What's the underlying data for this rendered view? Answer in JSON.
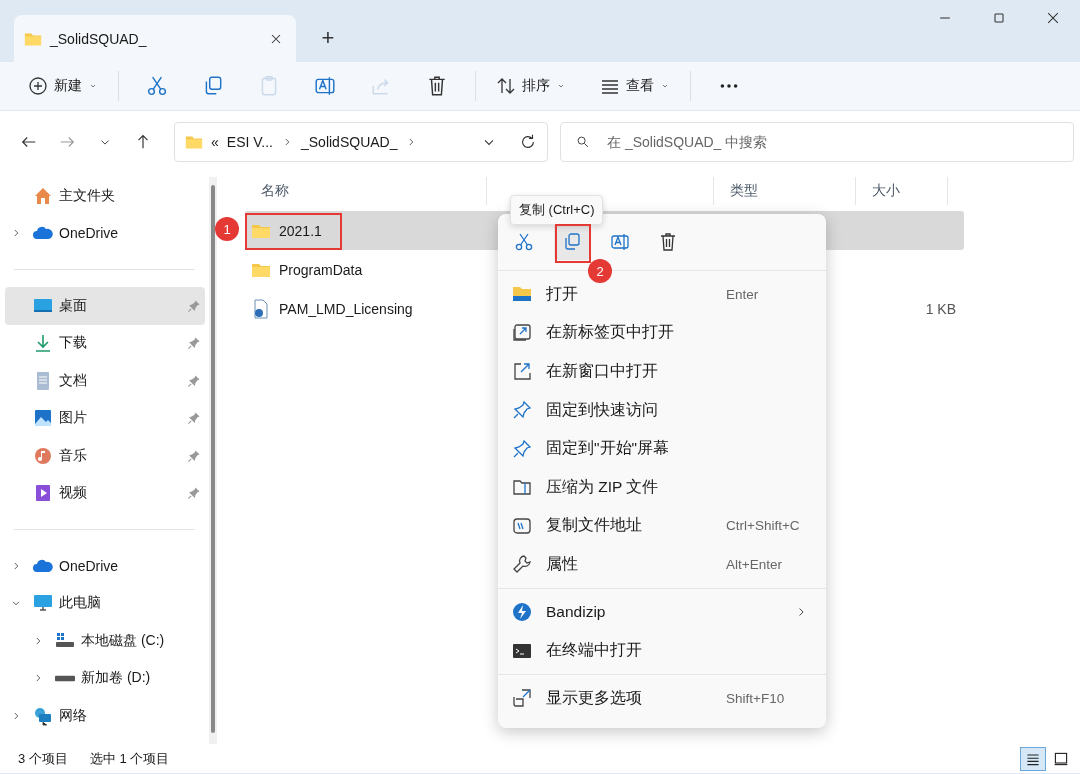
{
  "window": {
    "tab_title": "_SolidSQUAD_",
    "new_tab": "+"
  },
  "toolbar": {
    "new_label": "新建",
    "actions": [
      {
        "kind": "cut",
        "disabled": false
      },
      {
        "kind": "copy",
        "disabled": false
      },
      {
        "kind": "paste",
        "disabled": true
      },
      {
        "kind": "rename",
        "disabled": false
      },
      {
        "kind": "share",
        "disabled": true
      },
      {
        "kind": "delete",
        "disabled": false
      }
    ],
    "sort_label": "排序",
    "view_label": "查看"
  },
  "address": {
    "overflow": "«",
    "crumbs": [
      "ESI V...",
      "_SolidSQUAD_"
    ],
    "search_placeholder": "在 _SolidSQUAD_ 中搜索"
  },
  "sidebar": {
    "groups": [
      {
        "items": [
          {
            "label": "主文件夹",
            "kind": "home",
            "pinned": false,
            "selected": false
          },
          {
            "label": "OneDrive",
            "kind": "cloud",
            "expanded": false,
            "pinned": false,
            "selected": false
          }
        ]
      },
      {
        "items": [
          {
            "label": "桌面",
            "kind": "desktop",
            "pinned": true,
            "selected": true
          },
          {
            "label": "下载",
            "kind": "download",
            "pinned": true,
            "selected": false
          },
          {
            "label": "文档",
            "kind": "documents",
            "pinned": true,
            "selected": false
          },
          {
            "label": "图片",
            "kind": "pictures",
            "pinned": true,
            "selected": false
          },
          {
            "label": "音乐",
            "kind": "music",
            "pinned": true,
            "selected": false
          },
          {
            "label": "视频",
            "kind": "videos",
            "pinned": true,
            "selected": false
          }
        ]
      },
      {
        "items": [
          {
            "label": "OneDrive",
            "kind": "cloud",
            "expanded": false,
            "pinned": false,
            "selected": false
          },
          {
            "label": "此电脑",
            "kind": "pc",
            "expanded": true,
            "pinned": false,
            "selected": false,
            "children": [
              {
                "label": "本地磁盘 (C:)",
                "kind": "system-drive",
                "expanded": false,
                "pinned": false,
                "selected": false
              },
              {
                "label": "新加卷 (D:)",
                "kind": "drive",
                "expanded": false,
                "pinned": false,
                "selected": false
              }
            ]
          },
          {
            "label": "网络",
            "kind": "network",
            "expanded": false,
            "pinned": false,
            "selected": false
          }
        ]
      }
    ]
  },
  "files": {
    "columns": [
      "名称",
      "类型",
      "大小"
    ],
    "rows": [
      {
        "name": "2021.1",
        "kind": "folder",
        "size": "",
        "selected": true
      },
      {
        "name": "ProgramData",
        "kind": "folder",
        "size": "",
        "selected": false
      },
      {
        "name": "PAM_LMD_Licensing",
        "kind": "file",
        "size": "1 KB",
        "selected": false
      }
    ]
  },
  "context_menu": {
    "quick_actions": [
      {
        "kind": "cut",
        "hovered": false
      },
      {
        "kind": "copy",
        "hovered": true
      },
      {
        "kind": "rename",
        "hovered": false
      },
      {
        "kind": "delete",
        "hovered": false
      }
    ],
    "tooltip": "复制 (Ctrl+C)",
    "groups": [
      {
        "items": [
          {
            "label": "打开",
            "kind": "open",
            "shortcut": "Enter",
            "submenu": false
          },
          {
            "label": "在新标签页中打开",
            "kind": "new-tab",
            "submenu": false
          },
          {
            "label": "在新窗口中打开",
            "kind": "new-window",
            "submenu": false
          },
          {
            "label": "固定到快速访问",
            "kind": "pin",
            "submenu": false
          },
          {
            "label": "固定到\"开始\"屏幕",
            "kind": "pin",
            "submenu": false
          },
          {
            "label": "压缩为 ZIP 文件",
            "kind": "zip",
            "submenu": false
          },
          {
            "label": "复制文件地址",
            "kind": "path",
            "shortcut": "Ctrl+Shift+C",
            "submenu": false
          },
          {
            "label": "属性",
            "kind": "properties",
            "shortcut": "Alt+Enter",
            "submenu": false
          }
        ]
      },
      {
        "items": [
          {
            "label": "Bandizip",
            "kind": "bandizip",
            "submenu": true
          },
          {
            "label": "在终端中打开",
            "kind": "terminal",
            "submenu": false
          }
        ]
      },
      {
        "items": [
          {
            "label": "显示更多选项",
            "kind": "more",
            "shortcut": "Shift+F10",
            "submenu": false
          }
        ]
      }
    ]
  },
  "annotations": [
    {
      "label": "1"
    },
    {
      "label": "2"
    }
  ],
  "status_bar": {
    "count": "3 个项目",
    "selection": "选中 1 个项目",
    "views": [
      {
        "kind": "details",
        "selected": true
      },
      {
        "kind": "tiles",
        "selected": false
      }
    ]
  }
}
